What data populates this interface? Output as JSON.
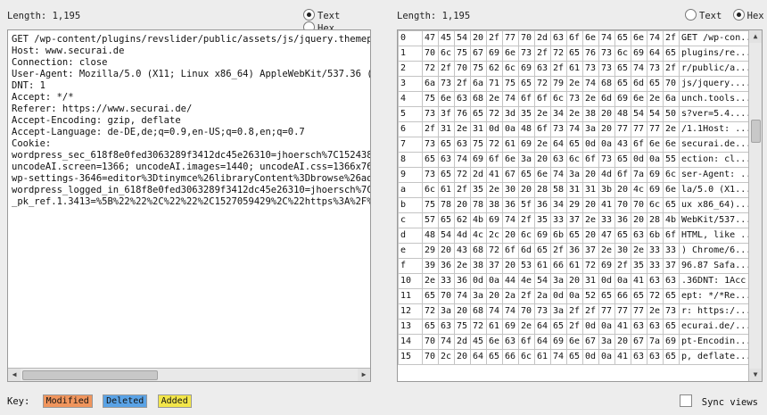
{
  "left": {
    "length_label": "Length: 1,195",
    "radio_text": "Text",
    "radio_hex": "Hex",
    "selected": "text",
    "lines": [
      "GET /wp-content/plugins/revslider/public/assets/js/jquery.themepunch",
      "Host: www.securai.de",
      "Connection: close",
      "User-Agent: Mozilla/5.0 (X11; Linux x86_64) AppleWebKit/537.36 (KHTML,",
      "DNT: 1",
      "Accept: */*",
      "Referer: https://www.securai.de/",
      "Accept-Encoding: gzip, deflate",
      "Accept-Language: de-DE,de;q=0.9,en-US;q=0.8,en;q=0.7",
      "Cookie:",
      "wordpress_sec_618f8e0fed3063289f3412dc45e26310=jhoersch%7C152438389",
      "uncodeAI.screen=1366; uncodeAI.images=1440; uncodeAI.css=1366x768@16",
      "wp-settings-3646=editor%3Dtinymce%26libraryContent%3Dbrowse%26advImg",
      "wordpress_logged_in_618f8e0fed3063289f3412dc45e26310=jhoersch%7C152",
      "_pk_ref.1.3413=%5B%22%22%2C%22%22%2C1527059429%2C%22https%3A%2F%2Fn"
    ]
  },
  "right": {
    "length_label": "Length: 1,195",
    "radio_text": "Text",
    "radio_hex": "Hex",
    "selected": "hex",
    "rows": [
      {
        "label": "0",
        "bytes": [
          "47",
          "45",
          "54",
          "20",
          "2f",
          "77",
          "70",
          "2d",
          "63",
          "6f",
          "6e",
          "74",
          "65",
          "6e",
          "74",
          "2f"
        ],
        "ascii": "GET /wp-con..."
      },
      {
        "label": "1",
        "bytes": [
          "70",
          "6c",
          "75",
          "67",
          "69",
          "6e",
          "73",
          "2f",
          "72",
          "65",
          "76",
          "73",
          "6c",
          "69",
          "64",
          "65"
        ],
        "ascii": "plugins/re..."
      },
      {
        "label": "2",
        "bytes": [
          "72",
          "2f",
          "70",
          "75",
          "62",
          "6c",
          "69",
          "63",
          "2f",
          "61",
          "73",
          "73",
          "65",
          "74",
          "73",
          "2f"
        ],
        "ascii": "r/public/a..."
      },
      {
        "label": "3",
        "bytes": [
          "6a",
          "73",
          "2f",
          "6a",
          "71",
          "75",
          "65",
          "72",
          "79",
          "2e",
          "74",
          "68",
          "65",
          "6d",
          "65",
          "70"
        ],
        "ascii": "js/jquery...."
      },
      {
        "label": "4",
        "bytes": [
          "75",
          "6e",
          "63",
          "68",
          "2e",
          "74",
          "6f",
          "6f",
          "6c",
          "73",
          "2e",
          "6d",
          "69",
          "6e",
          "2e",
          "6a"
        ],
        "ascii": "unch.tools..."
      },
      {
        "label": "5",
        "bytes": [
          "73",
          "3f",
          "76",
          "65",
          "72",
          "3d",
          "35",
          "2e",
          "34",
          "2e",
          "38",
          "20",
          "48",
          "54",
          "54",
          "50"
        ],
        "ascii": "s?ver=5.4...."
      },
      {
        "label": "6",
        "bytes": [
          "2f",
          "31",
          "2e",
          "31",
          "0d",
          "0a",
          "48",
          "6f",
          "73",
          "74",
          "3a",
          "20",
          "77",
          "77",
          "77",
          "2e"
        ],
        "ascii": "/1.1Host: ..."
      },
      {
        "label": "7",
        "bytes": [
          "73",
          "65",
          "63",
          "75",
          "72",
          "61",
          "69",
          "2e",
          "64",
          "65",
          "0d",
          "0a",
          "43",
          "6f",
          "6e",
          "6e"
        ],
        "ascii": "securai.de..."
      },
      {
        "label": "8",
        "bytes": [
          "65",
          "63",
          "74",
          "69",
          "6f",
          "6e",
          "3a",
          "20",
          "63",
          "6c",
          "6f",
          "73",
          "65",
          "0d",
          "0a",
          "55"
        ],
        "ascii": "ection: cl..."
      },
      {
        "label": "9",
        "bytes": [
          "73",
          "65",
          "72",
          "2d",
          "41",
          "67",
          "65",
          "6e",
          "74",
          "3a",
          "20",
          "4d",
          "6f",
          "7a",
          "69",
          "6c"
        ],
        "ascii": "ser-Agent: ..."
      },
      {
        "label": "a",
        "bytes": [
          "6c",
          "61",
          "2f",
          "35",
          "2e",
          "30",
          "20",
          "28",
          "58",
          "31",
          "31",
          "3b",
          "20",
          "4c",
          "69",
          "6e"
        ],
        "ascii": "la/5.0 (X1..."
      },
      {
        "label": "b",
        "bytes": [
          "75",
          "78",
          "20",
          "78",
          "38",
          "36",
          "5f",
          "36",
          "34",
          "29",
          "20",
          "41",
          "70",
          "70",
          "6c",
          "65"
        ],
        "ascii": "ux x86_64)..."
      },
      {
        "label": "c",
        "bytes": [
          "57",
          "65",
          "62",
          "4b",
          "69",
          "74",
          "2f",
          "35",
          "33",
          "37",
          "2e",
          "33",
          "36",
          "20",
          "28",
          "4b"
        ],
        "ascii": "WebKit/537..."
      },
      {
        "label": "d",
        "bytes": [
          "48",
          "54",
          "4d",
          "4c",
          "2c",
          "20",
          "6c",
          "69",
          "6b",
          "65",
          "20",
          "47",
          "65",
          "63",
          "6b",
          "6f"
        ],
        "ascii": "HTML, like ..."
      },
      {
        "label": "e",
        "bytes": [
          "29",
          "20",
          "43",
          "68",
          "72",
          "6f",
          "6d",
          "65",
          "2f",
          "36",
          "37",
          "2e",
          "30",
          "2e",
          "33",
          "33"
        ],
        "ascii": ") Chrome/6..."
      },
      {
        "label": "f",
        "bytes": [
          "39",
          "36",
          "2e",
          "38",
          "37",
          "20",
          "53",
          "61",
          "66",
          "61",
          "72",
          "69",
          "2f",
          "35",
          "33",
          "37"
        ],
        "ascii": "96.87 Safa..."
      },
      {
        "label": "10",
        "bytes": [
          "2e",
          "33",
          "36",
          "0d",
          "0a",
          "44",
          "4e",
          "54",
          "3a",
          "20",
          "31",
          "0d",
          "0a",
          "41",
          "63",
          "63"
        ],
        "ascii": ".36DNT: 1Acc"
      },
      {
        "label": "11",
        "bytes": [
          "65",
          "70",
          "74",
          "3a",
          "20",
          "2a",
          "2f",
          "2a",
          "0d",
          "0a",
          "52",
          "65",
          "66",
          "65",
          "72",
          "65"
        ],
        "ascii": "ept: */*Re..."
      },
      {
        "label": "12",
        "bytes": [
          "72",
          "3a",
          "20",
          "68",
          "74",
          "74",
          "70",
          "73",
          "3a",
          "2f",
          "2f",
          "77",
          "77",
          "77",
          "2e",
          "73"
        ],
        "ascii": "r: https:/..."
      },
      {
        "label": "13",
        "bytes": [
          "65",
          "63",
          "75",
          "72",
          "61",
          "69",
          "2e",
          "64",
          "65",
          "2f",
          "0d",
          "0a",
          "41",
          "63",
          "63",
          "65"
        ],
        "ascii": "ecurai.de/..."
      },
      {
        "label": "14",
        "bytes": [
          "70",
          "74",
          "2d",
          "45",
          "6e",
          "63",
          "6f",
          "64",
          "69",
          "6e",
          "67",
          "3a",
          "20",
          "67",
          "7a",
          "69"
        ],
        "ascii": "pt-Encodin..."
      },
      {
        "label": "15",
        "bytes": [
          "70",
          "2c",
          "20",
          "64",
          "65",
          "66",
          "6c",
          "61",
          "74",
          "65",
          "0d",
          "0a",
          "41",
          "63",
          "63",
          "65"
        ],
        "ascii": "p, deflate..."
      }
    ]
  },
  "key": {
    "label": "Key:",
    "items": [
      {
        "label": "Modified",
        "color": "#f0955d"
      },
      {
        "label": "Deleted",
        "color": "#5aa3e6"
      },
      {
        "label": "Added",
        "color": "#f3e64a"
      }
    ]
  },
  "sync": {
    "label": "Sync views",
    "checked": false
  }
}
